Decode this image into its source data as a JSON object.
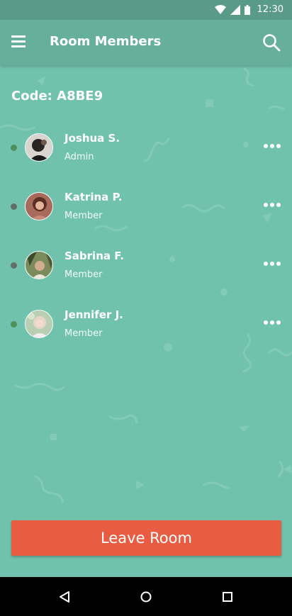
{
  "status_bar": {
    "time": "12:30"
  },
  "app_bar": {
    "title": "Room Members"
  },
  "room": {
    "code_label": "Code: A8BE9"
  },
  "members": [
    {
      "name": "Joshua S.",
      "role": "Admin",
      "online": true
    },
    {
      "name": "Katrina P.",
      "role": "Member",
      "online": false
    },
    {
      "name": "Sabrina F.",
      "role": "Member",
      "online": false
    },
    {
      "name": "Jennifer J.",
      "role": "Member",
      "online": true
    }
  ],
  "actions": {
    "leave_label": "Leave Room"
  },
  "colors": {
    "background": "#71c2ad",
    "app_bar": "#66b09b",
    "online_dot": "#4e8f5a",
    "offline_dot": "#5f6f6a",
    "leave_button": "#e85d41"
  }
}
